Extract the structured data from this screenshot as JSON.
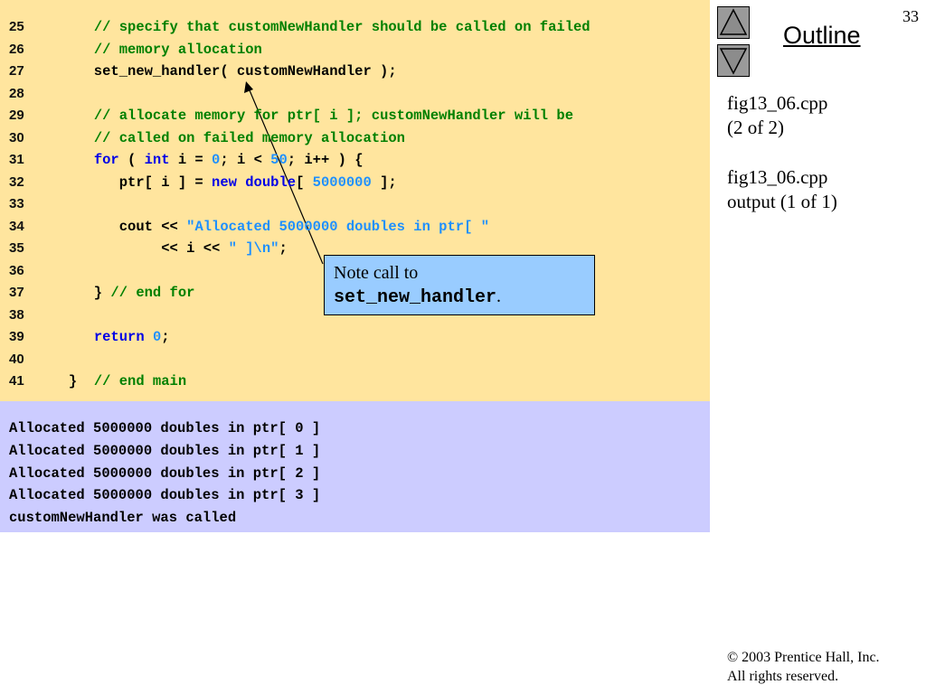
{
  "slide": {
    "page_number": "33",
    "outline_label": "Outline",
    "side_notes": [
      "fig13_06.cpp",
      "(2 of 2)",
      "fig13_06.cpp",
      "output (1 of 1)"
    ],
    "copyright_line1": "© 2003 Prentice Hall, Inc.",
    "copyright_line2": "All rights reserved."
  },
  "code": {
    "line_numbers": [
      "25",
      "26",
      "27",
      "28",
      "29",
      "30",
      "31",
      "32",
      "33",
      "34",
      "35",
      "36",
      "37",
      "38",
      "39",
      "40",
      "41"
    ],
    "lines": [
      [
        {
          "t": "      ",
          "c": ""
        },
        {
          "t": "// specify that customNewHandler should be called on failed",
          "c": "cm"
        }
      ],
      [
        {
          "t": "      ",
          "c": ""
        },
        {
          "t": "// memory allocation",
          "c": "cm"
        }
      ],
      [
        {
          "t": "      set_new_handler( customNewHandler );",
          "c": ""
        }
      ],
      [],
      [
        {
          "t": "      ",
          "c": ""
        },
        {
          "t": "// allocate memory for ptr[ i ]; customNewHandler will be",
          "c": "cm"
        }
      ],
      [
        {
          "t": "      ",
          "c": ""
        },
        {
          "t": "// called on failed memory allocation",
          "c": "cm"
        }
      ],
      [
        {
          "t": "      ",
          "c": ""
        },
        {
          "t": "for",
          "c": "kw"
        },
        {
          "t": " ( ",
          "c": ""
        },
        {
          "t": "int",
          "c": "kw"
        },
        {
          "t": " i = ",
          "c": ""
        },
        {
          "t": "0",
          "c": "num"
        },
        {
          "t": "; i < ",
          "c": ""
        },
        {
          "t": "50",
          "c": "num"
        },
        {
          "t": "; i++ ) {",
          "c": ""
        }
      ],
      [
        {
          "t": "         ptr[ i ] = ",
          "c": ""
        },
        {
          "t": "new",
          "c": "kw"
        },
        {
          "t": " ",
          "c": ""
        },
        {
          "t": "double",
          "c": "kw"
        },
        {
          "t": "[ ",
          "c": ""
        },
        {
          "t": "5000000",
          "c": "num"
        },
        {
          "t": " ];",
          "c": ""
        }
      ],
      [],
      [
        {
          "t": "         cout << ",
          "c": ""
        },
        {
          "t": "\"Allocated 5000000 doubles in ptr[ \"",
          "c": "str"
        }
      ],
      [
        {
          "t": "              << i << ",
          "c": ""
        },
        {
          "t": "\" ]\\n\"",
          "c": "str"
        },
        {
          "t": ";",
          "c": ""
        }
      ],
      [],
      [
        {
          "t": "      } ",
          "c": ""
        },
        {
          "t": "// end for",
          "c": "cm"
        }
      ],
      [],
      [
        {
          "t": "      ",
          "c": ""
        },
        {
          "t": "return",
          "c": "kw"
        },
        {
          "t": " ",
          "c": ""
        },
        {
          "t": "0",
          "c": "num"
        },
        {
          "t": ";",
          "c": ""
        }
      ],
      [],
      [
        {
          "t": "   }  ",
          "c": ""
        },
        {
          "t": "// end main",
          "c": "cm"
        }
      ]
    ]
  },
  "output": {
    "lines": [
      "Allocated 5000000 doubles in ptr[ 0 ]",
      "Allocated 5000000 doubles in ptr[ 1 ]",
      "Allocated 5000000 doubles in ptr[ 2 ]",
      "Allocated 5000000 doubles in ptr[ 3 ]",
      "customNewHandler was called"
    ]
  },
  "callout": {
    "text": "Note call to",
    "code": "set_new_handler",
    "suffix": "."
  },
  "colors": {
    "code_background": "#ffe59e",
    "output_background": "#ccccff",
    "callout_background": "#99ccff",
    "comment": "#008000",
    "keyword": "#0000e6",
    "literal": "#1e90ff"
  },
  "icons": {
    "previous": "triangle-up-icon",
    "next": "triangle-down-icon"
  }
}
